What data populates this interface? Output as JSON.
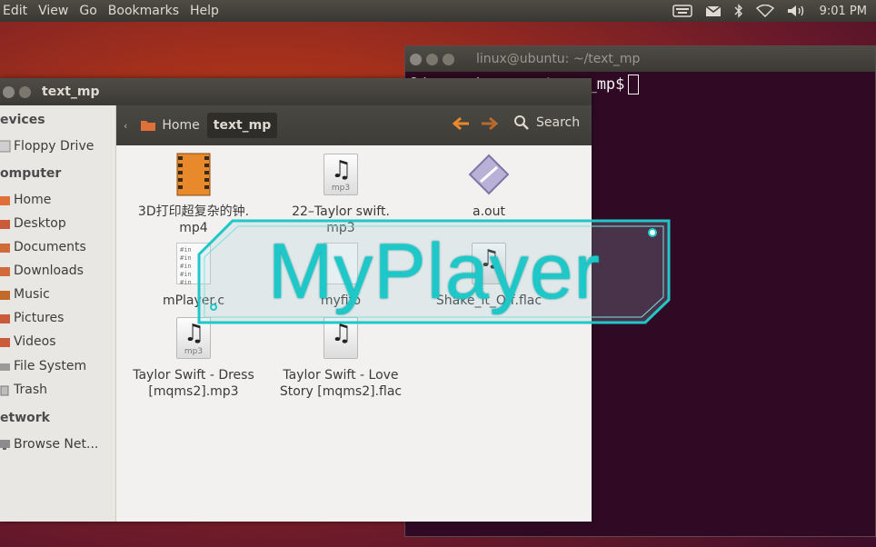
{
  "top_panel": {
    "menus": [
      "Edit",
      "View",
      "Go",
      "Bookmarks",
      "Help"
    ],
    "time": "9:01 PM",
    "tray_icons": [
      "keyboard-icon",
      "mail-icon",
      "bluetooth-icon",
      "wifi-icon",
      "volume-icon"
    ]
  },
  "terminal": {
    "title": "linux@ubuntu: ~/text_mp",
    "prompt": "linux@ubuntu:~/text_mp$"
  },
  "file_manager": {
    "title": "text_mp",
    "breadcrumb": {
      "home": "Home",
      "current": "text_mp"
    },
    "search_label": "Search",
    "sidebar": {
      "devices_heading": "evices",
      "floppy": "Floppy Drive",
      "computer_heading": "omputer",
      "home": "Home",
      "desktop": "Desktop",
      "documents": "Documents",
      "downloads": "Downloads",
      "music": "Music",
      "pictures": "Pictures",
      "videos": "Videos",
      "filesystem": "File System",
      "trash": "Trash",
      "network_heading": "etwork",
      "browse": "Browse Net..."
    },
    "files": [
      {
        "name_line1": "3D打印超复杂的钟.",
        "name_line2": "mp4",
        "type": "video"
      },
      {
        "name_line1": "22–Taylor swift.",
        "name_line2": "mp3",
        "type": "audio",
        "tag": "mp3"
      },
      {
        "name_line1": "a.out",
        "name_line2": "",
        "type": "executable"
      },
      {
        "name_line1": "mPlayer.c",
        "name_line2": "",
        "type": "text"
      },
      {
        "name_line1": "myfifo",
        "name_line2": "",
        "type": "text"
      },
      {
        "name_line1": "Shake_it_Off.flac",
        "name_line2": "",
        "type": "audio"
      },
      {
        "name_line1": "Taylor Swift - Dress",
        "name_line2": "[mqms2].mp3",
        "type": "audio",
        "tag": "mp3"
      },
      {
        "name_line1": "Taylor Swift - Love",
        "name_line2": "Story [mqms2].flac",
        "type": "audio"
      }
    ]
  },
  "overlay": {
    "text": "MyPlayer"
  },
  "colors": {
    "overlay_accent": "#1ec8c8",
    "terminal_bg": "#300a24",
    "nav_arrow": "#e8892c"
  }
}
